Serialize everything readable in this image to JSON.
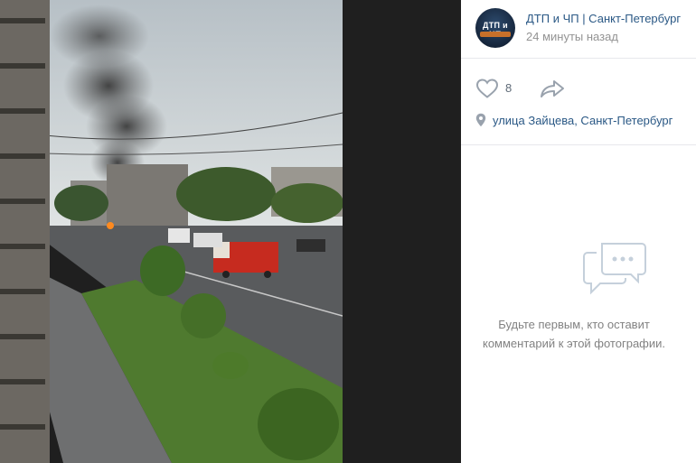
{
  "viewer": {
    "photo_description_icon": "photo"
  },
  "post": {
    "author": "ДТП и ЧП | Санкт-Петербург",
    "avatar_text": "ДТП и ЧП",
    "time": "24 минуты назад",
    "likes": "8",
    "like_icon": "heart-icon",
    "share_icon": "share-arrow-icon",
    "location_icon": "map-pin-icon",
    "location": "улица Зайцева, Санкт-Петербург"
  },
  "comments": {
    "empty_icon": "comments-icon",
    "empty_line1": "Будьте первым, кто оставит",
    "empty_line2": "комментарий к этой фотографии."
  },
  "colors": {
    "link": "#2a5885",
    "muted": "#939393",
    "icon": "#99a2ad",
    "viewer_bg": "#1f1f1f"
  }
}
